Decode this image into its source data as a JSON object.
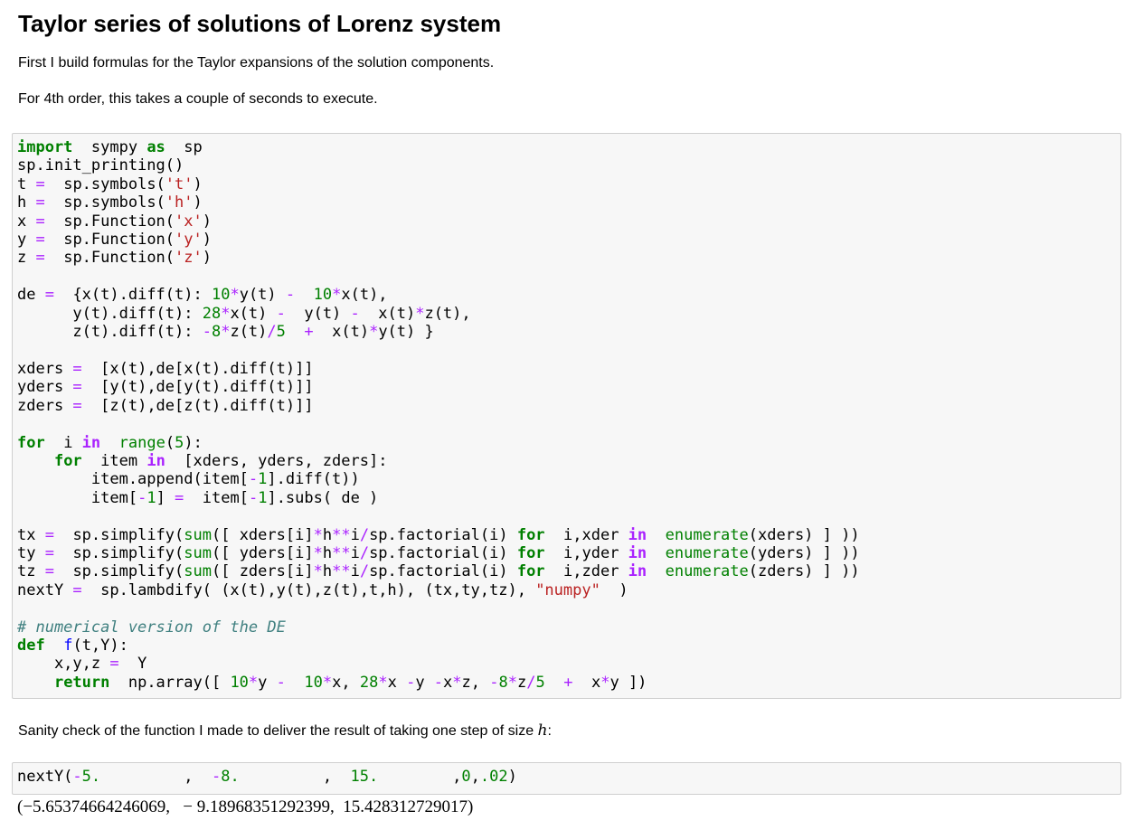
{
  "notebook": {
    "title": "Taylor series of solutions of Lorenz system",
    "intro_p1": "First I build formulas for the Taylor expansions of the solution components.",
    "intro_p2": "For 4th order, this takes a couple of seconds to execute.",
    "sanity_text_before": "Sanity check of the function I made to deliver the result of taking one step of size ",
    "sanity_math": "h",
    "sanity_text_after": ":",
    "output_text": "(−5.65374664246069,   − 9.18968351292399,  15.428312729017)"
  },
  "cell1": {
    "lines": [
      [
        [
          "k",
          "import"
        ],
        [
          "",
          "  sympy "
        ],
        [
          "k",
          "as"
        ],
        [
          "",
          "  sp"
        ]
      ],
      [
        [
          "",
          "sp.init_printing()"
        ]
      ],
      [
        [
          "",
          "t "
        ],
        [
          "o",
          "="
        ],
        [
          "",
          "  sp.symbols("
        ],
        [
          "s",
          "'t'"
        ],
        [
          "",
          ")"
        ]
      ],
      [
        [
          "",
          "h "
        ],
        [
          "o",
          "="
        ],
        [
          "",
          "  sp.symbols("
        ],
        [
          "s",
          "'h'"
        ],
        [
          "",
          ")"
        ]
      ],
      [
        [
          "",
          "x "
        ],
        [
          "o",
          "="
        ],
        [
          "",
          "  sp.Function("
        ],
        [
          "s",
          "'x'"
        ],
        [
          "",
          ")"
        ]
      ],
      [
        [
          "",
          "y "
        ],
        [
          "o",
          "="
        ],
        [
          "",
          "  sp.Function("
        ],
        [
          "s",
          "'y'"
        ],
        [
          "",
          ")"
        ]
      ],
      [
        [
          "",
          "z "
        ],
        [
          "o",
          "="
        ],
        [
          "",
          "  sp.Function("
        ],
        [
          "s",
          "'z'"
        ],
        [
          "",
          ")"
        ]
      ],
      [
        [
          "",
          ""
        ]
      ],
      [
        [
          "",
          "de "
        ],
        [
          "o",
          "="
        ],
        [
          "",
          "  {x(t).diff(t): "
        ],
        [
          "m",
          "10"
        ],
        [
          "o",
          "*"
        ],
        [
          "",
          "y(t) "
        ],
        [
          "o",
          "-"
        ],
        [
          "",
          "  "
        ],
        [
          "m",
          "10"
        ],
        [
          "o",
          "*"
        ],
        [
          "",
          "x(t),"
        ]
      ],
      [
        [
          "",
          "      y(t).diff(t): "
        ],
        [
          "m",
          "28"
        ],
        [
          "o",
          "*"
        ],
        [
          "",
          "x(t) "
        ],
        [
          "o",
          "-"
        ],
        [
          "",
          "  y(t) "
        ],
        [
          "o",
          "-"
        ],
        [
          "",
          "  x(t)"
        ],
        [
          "o",
          "*"
        ],
        [
          "",
          "z(t),"
        ]
      ],
      [
        [
          "",
          "      z(t).diff(t): "
        ],
        [
          "o",
          "-"
        ],
        [
          "m",
          "8"
        ],
        [
          "o",
          "*"
        ],
        [
          "",
          "z(t)"
        ],
        [
          "o",
          "/"
        ],
        [
          "m",
          "5"
        ],
        [
          "",
          "  "
        ],
        [
          "o",
          "+"
        ],
        [
          "",
          "  x(t)"
        ],
        [
          "o",
          "*"
        ],
        [
          "",
          "y(t) }"
        ]
      ],
      [
        [
          "",
          ""
        ]
      ],
      [
        [
          "",
          "xders "
        ],
        [
          "o",
          "="
        ],
        [
          "",
          "  [x(t),de[x(t).diff(t)]]"
        ]
      ],
      [
        [
          "",
          "yders "
        ],
        [
          "o",
          "="
        ],
        [
          "",
          "  [y(t),de[y(t).diff(t)]]"
        ]
      ],
      [
        [
          "",
          "zders "
        ],
        [
          "o",
          "="
        ],
        [
          "",
          "  [z(t),de[z(t).diff(t)]]"
        ]
      ],
      [
        [
          "",
          ""
        ]
      ],
      [
        [
          "k",
          "for"
        ],
        [
          "",
          "  i "
        ],
        [
          "ow",
          "in"
        ],
        [
          "",
          "  "
        ],
        [
          "nb2",
          "range"
        ],
        [
          "",
          "("
        ],
        [
          "m",
          "5"
        ],
        [
          "",
          "):"
        ]
      ],
      [
        [
          "",
          "    "
        ],
        [
          "k",
          "for"
        ],
        [
          "",
          "  item "
        ],
        [
          "ow",
          "in"
        ],
        [
          "",
          "  [xders, yders, zders]:"
        ]
      ],
      [
        [
          "",
          "        item.append(item["
        ],
        [
          "o",
          "-"
        ],
        [
          "m",
          "1"
        ],
        [
          "",
          "].diff(t))"
        ]
      ],
      [
        [
          "",
          "        item["
        ],
        [
          "o",
          "-"
        ],
        [
          "m",
          "1"
        ],
        [
          "",
          "] "
        ],
        [
          "o",
          "="
        ],
        [
          "",
          "  item["
        ],
        [
          "o",
          "-"
        ],
        [
          "m",
          "1"
        ],
        [
          "",
          "].subs( de )"
        ]
      ],
      [
        [
          "",
          ""
        ]
      ],
      [
        [
          "",
          "tx "
        ],
        [
          "o",
          "="
        ],
        [
          "",
          "  sp.simplify("
        ],
        [
          "nb2",
          "sum"
        ],
        [
          "",
          "([ xders[i]"
        ],
        [
          "o",
          "*"
        ],
        [
          "",
          "h"
        ],
        [
          "o",
          "**"
        ],
        [
          "",
          "i"
        ],
        [
          "o",
          "/"
        ],
        [
          "",
          "sp.factorial(i) "
        ],
        [
          "k",
          "for"
        ],
        [
          "",
          "  i,xder "
        ],
        [
          "ow",
          "in"
        ],
        [
          "",
          "  "
        ],
        [
          "nb2",
          "enumerate"
        ],
        [
          "",
          "(xders) ] ))"
        ]
      ],
      [
        [
          "",
          "ty "
        ],
        [
          "o",
          "="
        ],
        [
          "",
          "  sp.simplify("
        ],
        [
          "nb2",
          "sum"
        ],
        [
          "",
          "([ yders[i]"
        ],
        [
          "o",
          "*"
        ],
        [
          "",
          "h"
        ],
        [
          "o",
          "**"
        ],
        [
          "",
          "i"
        ],
        [
          "o",
          "/"
        ],
        [
          "",
          "sp.factorial(i) "
        ],
        [
          "k",
          "for"
        ],
        [
          "",
          "  i,yder "
        ],
        [
          "ow",
          "in"
        ],
        [
          "",
          "  "
        ],
        [
          "nb2",
          "enumerate"
        ],
        [
          "",
          "(yders) ] ))"
        ]
      ],
      [
        [
          "",
          "tz "
        ],
        [
          "o",
          "="
        ],
        [
          "",
          "  sp.simplify("
        ],
        [
          "nb2",
          "sum"
        ],
        [
          "",
          "([ zders[i]"
        ],
        [
          "o",
          "*"
        ],
        [
          "",
          "h"
        ],
        [
          "o",
          "**"
        ],
        [
          "",
          "i"
        ],
        [
          "o",
          "/"
        ],
        [
          "",
          "sp.factorial(i) "
        ],
        [
          "k",
          "for"
        ],
        [
          "",
          "  i,zder "
        ],
        [
          "ow",
          "in"
        ],
        [
          "",
          "  "
        ],
        [
          "nb2",
          "enumerate"
        ],
        [
          "",
          "(zders) ] ))"
        ]
      ],
      [
        [
          "",
          "nextY "
        ],
        [
          "o",
          "="
        ],
        [
          "",
          "  sp.lambdify( (x(t),y(t),z(t),t,h), (tx,ty,tz), "
        ],
        [
          "s",
          "\"numpy\""
        ],
        [
          "",
          "  )"
        ]
      ],
      [
        [
          "",
          ""
        ]
      ],
      [
        [
          "c",
          "# numerical version of the DE"
        ]
      ],
      [
        [
          "k",
          "def"
        ],
        [
          "",
          "  "
        ],
        [
          "nf",
          "f"
        ],
        [
          "",
          "(t,Y):"
        ]
      ],
      [
        [
          "",
          "    x,y,z "
        ],
        [
          "o",
          "="
        ],
        [
          "",
          "  Y"
        ]
      ],
      [
        [
          "",
          "    "
        ],
        [
          "k",
          "return"
        ],
        [
          "",
          "  np.array([ "
        ],
        [
          "m",
          "10"
        ],
        [
          "o",
          "*"
        ],
        [
          "",
          "y "
        ],
        [
          "o",
          "-"
        ],
        [
          "",
          "  "
        ],
        [
          "m",
          "10"
        ],
        [
          "o",
          "*"
        ],
        [
          "",
          "x, "
        ],
        [
          "m",
          "28"
        ],
        [
          "o",
          "*"
        ],
        [
          "",
          "x "
        ],
        [
          "o",
          "-"
        ],
        [
          "",
          "y "
        ],
        [
          "o",
          "-"
        ],
        [
          "",
          "x"
        ],
        [
          "o",
          "*"
        ],
        [
          "",
          "z, "
        ],
        [
          "o",
          "-"
        ],
        [
          "m",
          "8"
        ],
        [
          "o",
          "*"
        ],
        [
          "",
          "z"
        ],
        [
          "o",
          "/"
        ],
        [
          "m",
          "5"
        ],
        [
          "",
          "  "
        ],
        [
          "o",
          "+"
        ],
        [
          "",
          "  x"
        ],
        [
          "o",
          "*"
        ],
        [
          "",
          "y ])"
        ]
      ]
    ]
  },
  "cell2": {
    "lines": [
      [
        [
          "",
          "nextY("
        ],
        [
          "o",
          "-"
        ],
        [
          "m",
          "5."
        ],
        [
          "",
          "         ,  "
        ],
        [
          "o",
          "-"
        ],
        [
          "m",
          "8."
        ],
        [
          "",
          "         ,  "
        ],
        [
          "m",
          "15."
        ],
        [
          "",
          "        ,"
        ],
        [
          "m",
          "0"
        ],
        [
          "",
          ","
        ],
        [
          "m",
          ".02"
        ],
        [
          "",
          ")"
        ]
      ]
    ]
  }
}
